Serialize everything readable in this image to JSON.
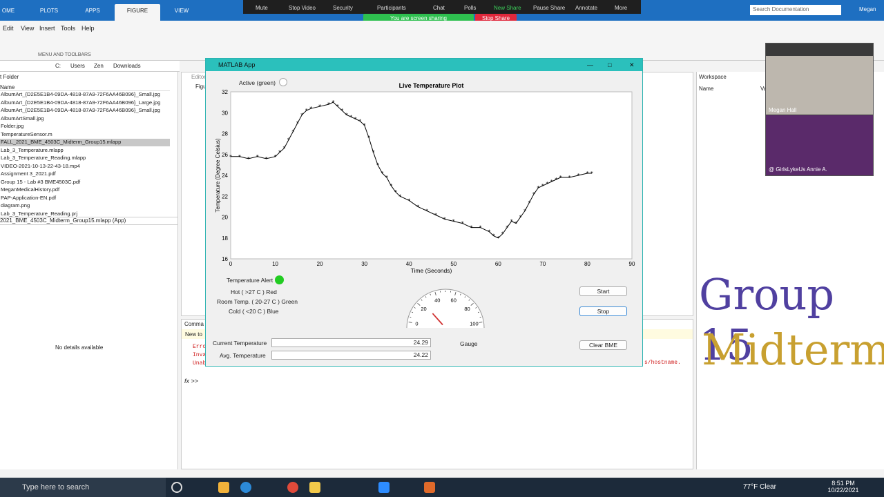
{
  "matlab": {
    "tabs": [
      {
        "label": "OME"
      },
      {
        "label": "PLOTS"
      },
      {
        "label": "APPS"
      },
      {
        "label": "FIGURE"
      },
      {
        "label": "VIEW"
      }
    ],
    "menu": [
      "Edit",
      "View",
      "Insert",
      "Tools",
      "Help"
    ],
    "ribbon_section": "MENU AND TOOLBARS",
    "address": [
      "C:",
      "Users",
      "Zen",
      "Downloads"
    ],
    "search_placeholder": "Search Documentation",
    "user": "Megan"
  },
  "zoom": {
    "items": [
      "Mute",
      "Stop Video",
      "Security",
      "Participants",
      "Chat",
      "Polls",
      "New Share",
      "Pause Share",
      "Annotate",
      "More"
    ],
    "sharing_text": "You are screen sharing",
    "stop_share": "Stop Share"
  },
  "folder": {
    "title": "t Folder",
    "column": "Name",
    "files": [
      "AlbumArt_{D2E5E1B4-09DA-4818-87A9-72F6AA46B096}_Small.jpg",
      "AlbumArt_{D2E5E1B4-09DA-4818-87A9-72F6AA46B096}_Large.jpg",
      "AlbumArt_{D2E5E1B4-09DA-4818-87A9-72F6AA46B096}_Small.jpg",
      "AlbumArtSmall.jpg",
      "Folder.jpg",
      "TemperatureSensor.m",
      "FALL_2021_BME_4503C_Midterm_Group15.mlapp",
      "Lab_3_Temperature.mlapp",
      "Lab_3_Temperature_Reading.mlapp",
      "VIDEO-2021-10-13-22-43-18.mp4",
      "Assignment 3_2021.pdf",
      "Group 15 - Lab #3 BME4503C.pdf",
      "MeganMedicalHistory.pdf",
      "PAP-Application-EN.pdf",
      "diagram.png",
      "Lab_3_Temperature_Reading.prj"
    ],
    "selected_file": "2021_BME_4503C_Midterm_Group15.mlapp  (App)",
    "details": "No details available"
  },
  "editor_tab": "Editor",
  "figure_tab": "Figu",
  "workspace": {
    "title": "Workspace",
    "col_name": "Name",
    "col_value": "Va"
  },
  "command": {
    "title": "Comma",
    "newto": "New to",
    "errors": [
      "Erro",
      "Inva",
      "Unab"
    ],
    "hostname": "s/hostname.",
    "prompt": ">>"
  },
  "app": {
    "title": "MATLAB App",
    "active_label": "Active (green)",
    "temp_alert": "Temperature Alert",
    "hot": "Hot ( >27 C ) Red",
    "room": "Room Temp. ( 20-27 C ) Green",
    "cold": "Cold ( <20 C ) Blue",
    "current_label": "Current Temperature",
    "current_value": "24.29",
    "avg_label": "Avg. Temperature",
    "avg_value": "24.22",
    "gauge_label": "Gauge",
    "start": "Start",
    "stop": "Stop",
    "clear": "Clear BME",
    "gauge": {
      "ticks": [
        "0",
        "20",
        "40",
        "60",
        "80",
        "100"
      ],
      "value": 24.29
    }
  },
  "chart_data": {
    "type": "line",
    "title": "Live Temperature Plot",
    "xlabel": "Time (Seconds)",
    "ylabel": "Temperature (Degree Celsius)",
    "xlim": [
      0,
      90
    ],
    "ylim": [
      16,
      32
    ],
    "xticks": [
      "0",
      "10",
      "20",
      "30",
      "40",
      "50",
      "60",
      "70",
      "80",
      "90"
    ],
    "yticks": [
      "16",
      "18",
      "20",
      "22",
      "24",
      "26",
      "28",
      "30",
      "32"
    ],
    "x": [
      0,
      2,
      4,
      6,
      8,
      10,
      11,
      12,
      13,
      14,
      15,
      16,
      17,
      18,
      20,
      22,
      23,
      24,
      25,
      26,
      27,
      28,
      29,
      30,
      31,
      32,
      33,
      34,
      35,
      36,
      37,
      38,
      40,
      42,
      44,
      46,
      48,
      50,
      52,
      54,
      56,
      58,
      59,
      60,
      61,
      62,
      63,
      64,
      65,
      66,
      67,
      68,
      69,
      70,
      71,
      72,
      73,
      74,
      76,
      78,
      80,
      81
    ],
    "y": [
      25.8,
      25.8,
      25.6,
      25.8,
      25.6,
      25.8,
      26.2,
      26.6,
      27.4,
      28.2,
      29.0,
      29.8,
      30.2,
      30.4,
      30.6,
      30.8,
      31.0,
      30.6,
      30.2,
      29.8,
      29.6,
      29.4,
      29.2,
      28.8,
      27.6,
      26.2,
      25.0,
      24.2,
      23.8,
      23.0,
      22.4,
      22.0,
      21.6,
      21.0,
      20.6,
      20.2,
      19.8,
      19.6,
      19.4,
      19.0,
      19.0,
      18.6,
      18.2,
      18.0,
      18.4,
      19.0,
      19.6,
      19.4,
      20.0,
      20.6,
      21.4,
      22.2,
      22.8,
      23.0,
      23.2,
      23.4,
      23.6,
      23.8,
      23.8,
      24.0,
      24.2,
      24.2
    ]
  },
  "video": {
    "name1": "Megan Hall",
    "name2": "@ GirlsLykeUs    Annie A."
  },
  "graffiti": {
    "line1": "Group 15",
    "line2": "Midterm"
  },
  "taskbar": {
    "search": "Type here to search",
    "weather": "77°F  Clear",
    "time": "8:51 PM",
    "date": "10/22/2021"
  }
}
